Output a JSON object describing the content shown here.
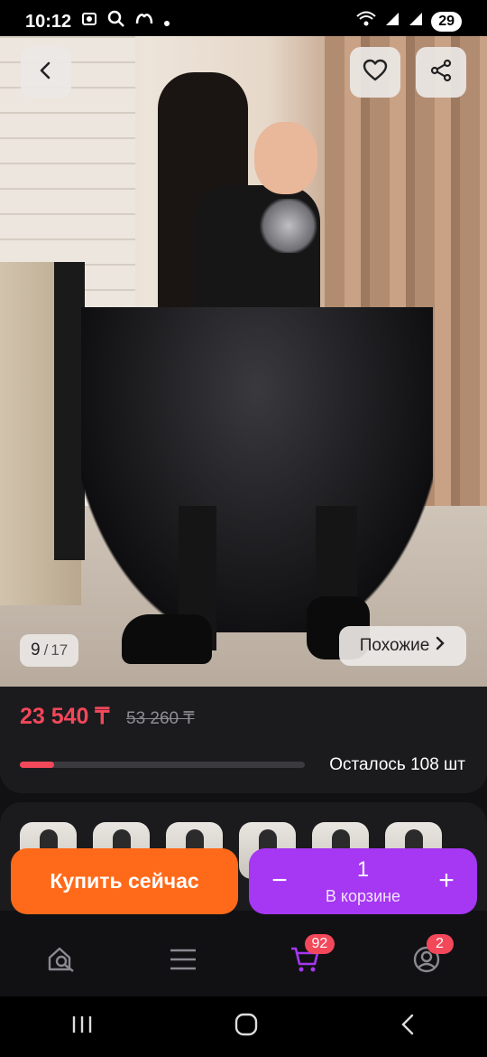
{
  "status_bar": {
    "time": "10:12",
    "battery": "29"
  },
  "gallery": {
    "current": "9",
    "total": "17",
    "separator": "/",
    "similar_label": "Похожие"
  },
  "product": {
    "price": "23 540 ₸",
    "old_price": "53 260 ₸",
    "stock_text": "Осталось 108 шт",
    "stock_fraction": 0.12
  },
  "actions": {
    "buy_now": "Купить сейчас",
    "quantity": "1",
    "in_cart": "В корзине",
    "minus": "−",
    "plus": "+"
  },
  "nav": {
    "cart_badge": "92",
    "profile_badge": "2",
    "items": [
      "search-icon",
      "menu-icon",
      "cart-icon",
      "profile-icon"
    ]
  },
  "colors": {
    "accent_red": "#f2485a",
    "buy_orange": "#ff6a1a",
    "cart_purple": "#a637f2"
  }
}
